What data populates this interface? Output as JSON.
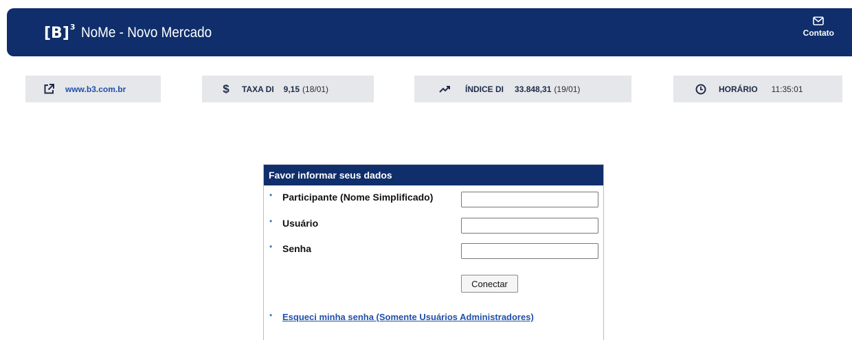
{
  "header": {
    "logo": "[B]",
    "logo_sup": "3",
    "title": "NoMe - Novo Mercado",
    "contact_label": "Contato",
    "contact_icon": "mail-icon"
  },
  "info_bars": {
    "site": {
      "icon": "external-link-icon",
      "link": "www.b3.com.br"
    },
    "taxa": {
      "icon": "dollar-icon",
      "symbol": "$",
      "label": "TAXA DI",
      "value": "9,15",
      "date": "(18/01)"
    },
    "indice": {
      "icon": "trending-up-icon",
      "label": "ÍNDICE DI",
      "value": "33.848,31",
      "date": "(19/01)"
    },
    "horario": {
      "icon": "clock-icon",
      "label": "HORÁRIO",
      "value": "11:35:01"
    }
  },
  "login": {
    "header": "Favor informar seus dados",
    "bullet": "•",
    "fields": [
      {
        "label": "Participante (Nome Simplificado)",
        "value": ""
      },
      {
        "label": "Usuário",
        "value": ""
      },
      {
        "label": "Senha",
        "value": ""
      }
    ],
    "connect_label": "Conectar",
    "forgot_label": "Esqueci minha senha (Somente Usuários Administradores)"
  },
  "colors": {
    "primary": "#0f2e6b",
    "info_bg": "#e5e7ea",
    "link": "#1f4faa",
    "bullet": "#3a6fd0"
  }
}
